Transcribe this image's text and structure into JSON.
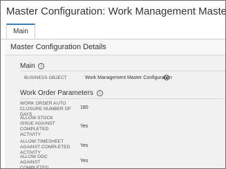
{
  "page": {
    "title": "Master Configuration: Work Management Master Configuration"
  },
  "tabs": [
    {
      "label": "Main",
      "active": true
    }
  ],
  "panel": {
    "title": "Master Configuration Details"
  },
  "main_section": {
    "title": "Main",
    "business_object": {
      "label": "BUSINESS OBJECT",
      "value": "Work Management Master Configuration"
    }
  },
  "work_order_section": {
    "title": "Work Order Parameters",
    "fields": [
      {
        "label": "WORK ORDER AUTO CLOSURE NUMBER OF DAYS",
        "value": "180"
      },
      {
        "label": "ALLOW STOCK ISSUE AGAINST COMPLETED ACTIVITY",
        "value": "Yes"
      },
      {
        "label": "ALLOW TIMESHEET AGAINST COMPLETED ACTIVITY",
        "value": "Yes"
      },
      {
        "label": "ALLOW ODC AGAINST COMPLETED ACTIVITY",
        "value": "Yes"
      }
    ]
  },
  "icons": {
    "info": "info-circle-icon",
    "dropdown": "chevron-down-circle-icon"
  },
  "colors": {
    "accent": "#3d7ab8",
    "panel_bg": "#f1f1f1"
  }
}
